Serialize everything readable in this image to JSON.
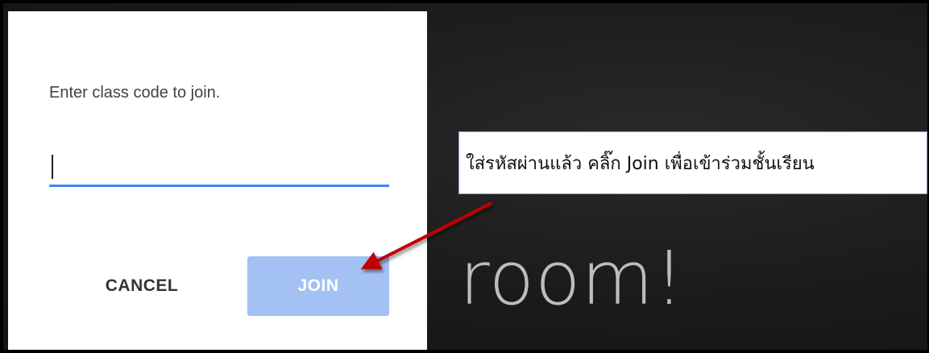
{
  "background": {
    "partial_heading": "room!"
  },
  "dialog": {
    "prompt": "Enter class code to join.",
    "code_input_value": "",
    "cancel_label": "CANCEL",
    "join_label": "JOIN"
  },
  "annotation": {
    "callout_text": "ใส่รหัสผ่านแล้ว คลิ๊ก Join เพื่อเข้าร่วมชั้นเรียน",
    "arrow_color": "#c00000"
  },
  "colors": {
    "input_underline": "#4285f4",
    "join_button_disabled": "#a4c1f3"
  }
}
